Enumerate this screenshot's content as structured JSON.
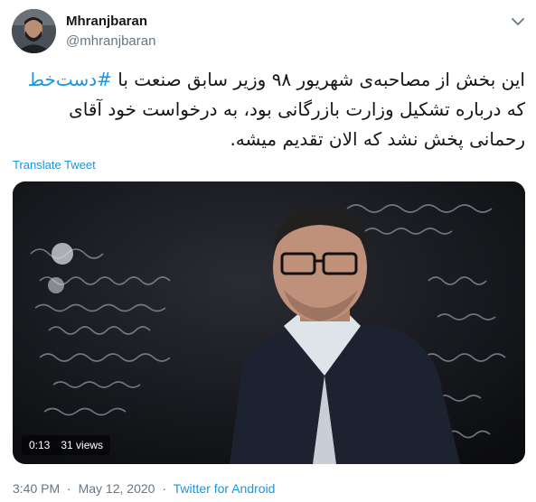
{
  "user": {
    "display_name": "Mhranjbaran",
    "handle": "@mhranjbaran"
  },
  "tweet": {
    "text_before_hashtag": "این بخش از مصاحبه‌ی شهریور ۹۸ وزیر سابق صنعت با ",
    "hashtag": "#دست‌خط",
    "text_after_hashtag": " که درباره تشکیل وزارت بازرگانی بود، به درخواست خود آقای رحمانی پخش نشد که الان تقدیم میشه.",
    "translate_label": "Translate Tweet"
  },
  "video": {
    "duration": "0:13",
    "views": "31 views"
  },
  "meta": {
    "time": "3:40 PM",
    "date": "May 12, 2020",
    "source": "Twitter for Android",
    "separator": "·"
  },
  "icons": {
    "menu": "chevron-down-icon",
    "avatar": "profile-photo"
  },
  "colors": {
    "link": "#1b95e0",
    "secondary_text": "#657786",
    "primary_text": "#14171a"
  }
}
